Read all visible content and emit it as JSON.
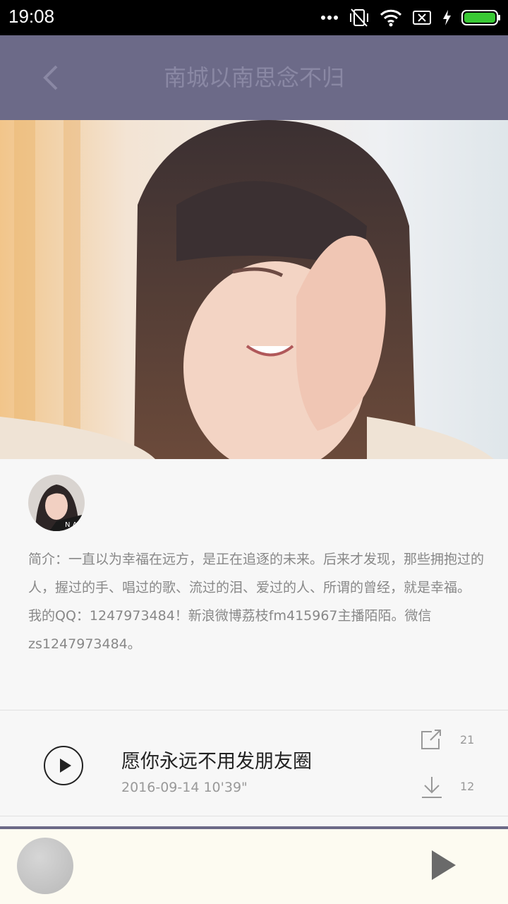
{
  "status": {
    "time": "19:08"
  },
  "header": {
    "title": "南城以南思念不归"
  },
  "intro": {
    "line1": "简介：一直以为幸福在远方，是正在追逐的未来。后来才发现，那些拥抱过的人，握过的手、唱过的歌、流过的泪、爱过的人、所谓的曾经，就是幸福。",
    "line2": "我的QQ：1247973484！新浪微博荔枝fm415967主播陌陌。微信zs1247973484。"
  },
  "track": {
    "title": "愿你永远不用发朋友圈",
    "meta": "2016-09-14  10'39\"",
    "share_count": "21",
    "download_count": "12"
  },
  "colors": {
    "accent": "#6c6a88",
    "player_bg": "#fdfbf1"
  }
}
